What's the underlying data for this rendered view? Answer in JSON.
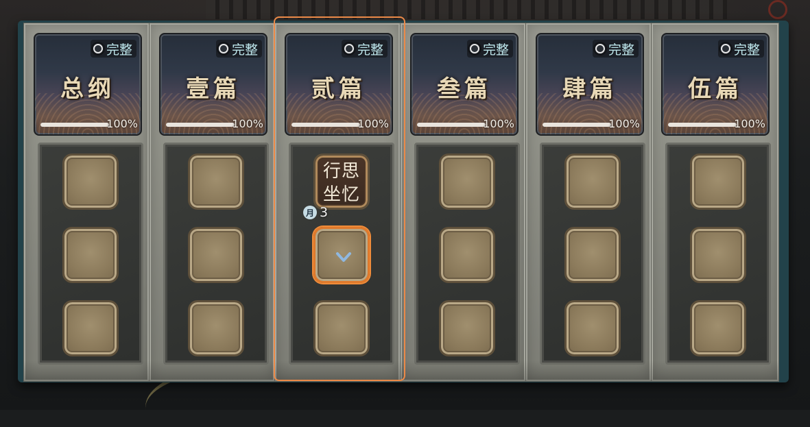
{
  "chapters": [
    {
      "title": "总纲",
      "status": "完整",
      "progress": 100,
      "progress_label": "100%"
    },
    {
      "title": "壹篇",
      "status": "完整",
      "progress": 100,
      "progress_label": "100%"
    },
    {
      "title": "贰篇",
      "status": "完整",
      "progress": 100,
      "progress_label": "100%",
      "card": {
        "line1": "行思",
        "line2": "坐忆",
        "month_icon": "月",
        "month_count": "3"
      }
    },
    {
      "title": "叁篇",
      "status": "完整",
      "progress": 100,
      "progress_label": "100%"
    },
    {
      "title": "肆篇",
      "status": "完整",
      "progress": 100,
      "progress_label": "100%"
    },
    {
      "title": "伍篇",
      "status": "完整",
      "progress": 100,
      "progress_label": "100%"
    }
  ],
  "colors": {
    "selection_outline": "#ec8a48",
    "status_text": "#bfe7ec",
    "chevron": "#8fb8e0"
  },
  "icons": {
    "status": "circle-icon",
    "month": "moon-icon",
    "slot_marker": "chevron-down-icon"
  }
}
